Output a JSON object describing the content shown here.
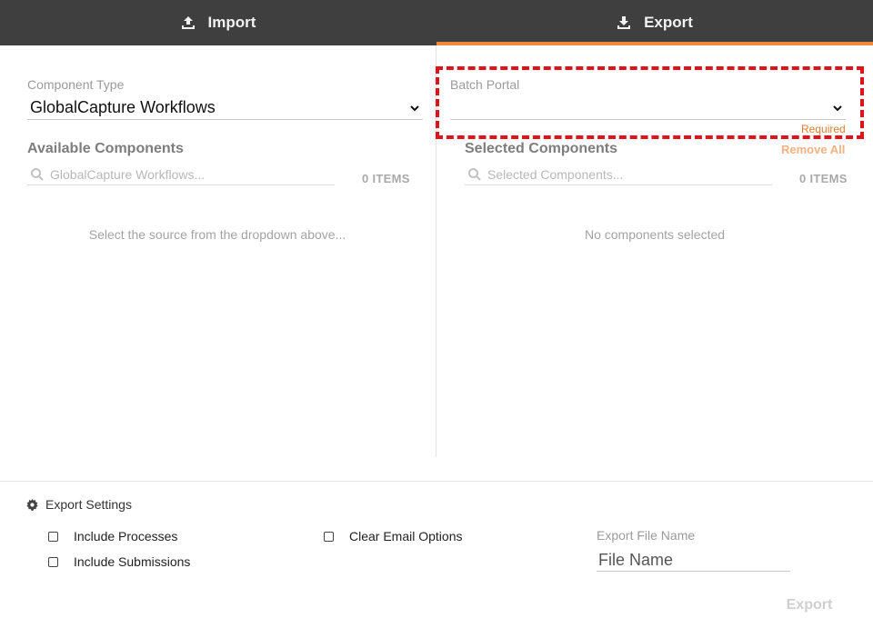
{
  "tabs": {
    "import": {
      "label": "Import",
      "icon": "upload-icon"
    },
    "export": {
      "label": "Export",
      "icon": "download-icon",
      "active": true
    }
  },
  "left": {
    "component_type_label": "Component Type",
    "component_type_value": "GlobalCapture Workflows",
    "available_title": "Available Components",
    "search_placeholder": "GlobalCapture Workflows...",
    "items_count": "0 ITEMS",
    "empty_message": "Select the source from the dropdown above..."
  },
  "right": {
    "batch_portal_label": "Batch Portal",
    "batch_portal_value": "",
    "required_text": "Required",
    "selected_title": "Selected Components",
    "remove_all": "Remove All",
    "search_placeholder": "Selected Components...",
    "items_count": "0 ITEMS",
    "empty_message": "No components selected"
  },
  "settings": {
    "title": "Export Settings",
    "options": {
      "include_processes": "Include Processes",
      "include_submissions": "Include Submissions",
      "clear_email_options": "Clear Email Options"
    },
    "file_name_label": "Export File Name",
    "file_name_placeholder": "File Name",
    "export_button": "Export"
  },
  "colors": {
    "accent": "#f0883e",
    "highlight": "#e0131a",
    "tabbar": "#3f3f3f"
  }
}
